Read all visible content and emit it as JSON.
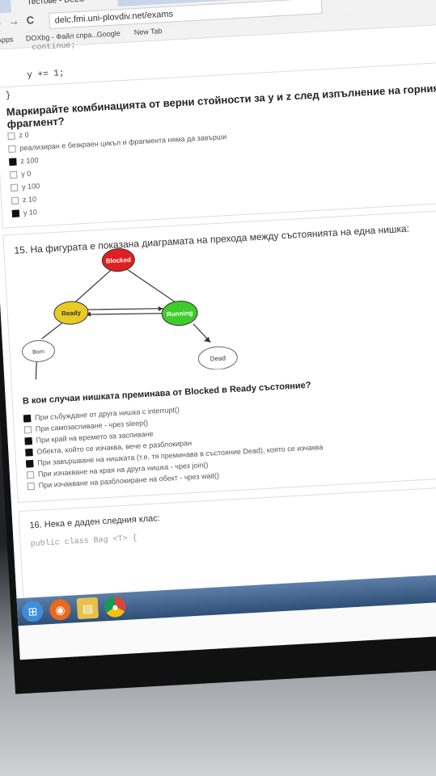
{
  "browser": {
    "tab_title": "Тестове - DeLC",
    "tab_close": "×",
    "url": "delc.fmi.uni-plovdiv.net/exams",
    "bookmarks": [
      "Apps",
      "DOXbg - Файл спра...",
      "Google",
      "New Tab"
    ]
  },
  "q14": {
    "code_top": "continue;",
    "code_line": "y += 1;",
    "code_brace": "}",
    "prompt": "Маркирайте комбинацията от верни стойности за y и z след изпълнение на горния фрагмент?",
    "options": [
      {
        "label": "z 0",
        "checked": false
      },
      {
        "label": "реализиран е безкраен цикъл и фрагмента няма да завърши",
        "checked": false
      },
      {
        "label": "z 100",
        "checked": true
      },
      {
        "label": "y 0",
        "checked": false
      },
      {
        "label": "y 100",
        "checked": false
      },
      {
        "label": "z 10",
        "checked": false
      },
      {
        "label": "y 10",
        "checked": true
      }
    ]
  },
  "q15": {
    "title": "15. На фигурата е показана диаграмата на прехода между състоянията на една нишка:",
    "diagram": {
      "states": [
        "Blocked",
        "Ready",
        "Running",
        "Born",
        "Dead"
      ],
      "colors": {
        "blocked": "#e02020",
        "ready": "#e8cc24",
        "running": "#3ecc2a",
        "plain": "#ffffff"
      }
    },
    "prompt": "В кои случаи нишката преминава от Blocked в Ready състояние?",
    "options": [
      {
        "label": "При събуждане от друга нишка с interrupt()",
        "checked": true
      },
      {
        "label": "При самозаспиване - чрез sleep()",
        "checked": false
      },
      {
        "label": "При край на времето за заспиване",
        "checked": true
      },
      {
        "label": "Обекта, който се изчаква, вече е разблокиран",
        "checked": true
      },
      {
        "label": "При завършване на нишката (т.е. тя преминава в състояние Dead), която се изчаква",
        "checked": true
      },
      {
        "label": "При изчакване на края на друга нишка - чрез join()",
        "checked": false
      },
      {
        "label": "При изчакване на разблокиране на обект - чрез wait()",
        "checked": false
      }
    ]
  },
  "q16": {
    "title": "16. Нека е даден следния клас:",
    "code": "public class Bag <T> {"
  },
  "taskbar": {
    "icons": [
      "windows-start-icon",
      "firefox-icon",
      "file-explorer-icon",
      "chrome-icon"
    ]
  }
}
